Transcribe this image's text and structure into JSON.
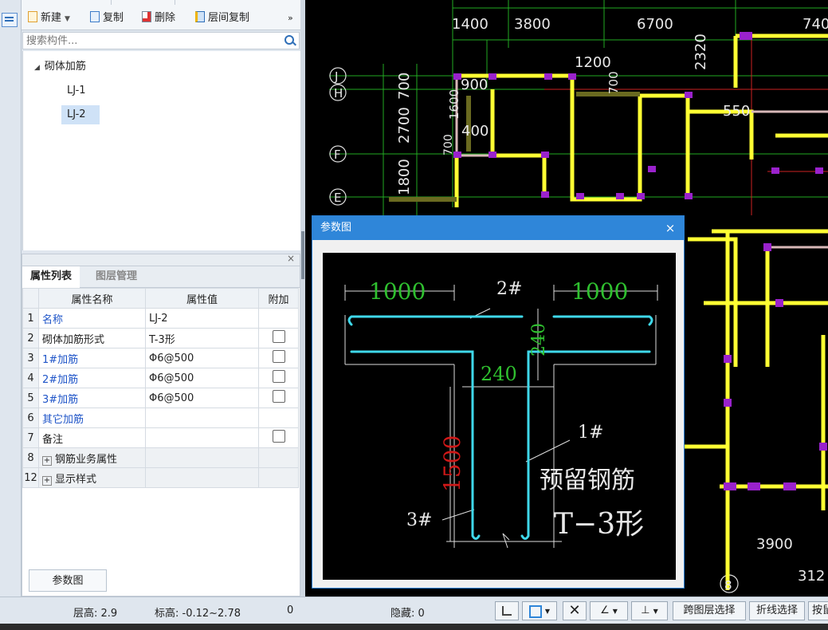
{
  "toolbar": {
    "new_label": "新建",
    "copy_label": "复制",
    "delete_label": "删除",
    "floor_copy_label": "层间复制",
    "more_label": "»"
  },
  "search": {
    "placeholder": "搜索构件..."
  },
  "tree": {
    "root_label": "砌体加筋",
    "items": [
      "LJ-1",
      "LJ-2"
    ],
    "selected": "LJ-2"
  },
  "props": {
    "close_label": "×",
    "tabs": [
      "属性列表",
      "图层管理"
    ],
    "headers": [
      "属性名称",
      "属性值",
      "附加"
    ],
    "rows": [
      {
        "num": "1",
        "name": "名称",
        "value": "LJ-2",
        "check": false
      },
      {
        "num": "2",
        "name": "砌体加筋形式",
        "value": "T-3形",
        "check": true
      },
      {
        "num": "3",
        "name": "1#加筋",
        "value": "Φ6@500",
        "check": true
      },
      {
        "num": "4",
        "name": "2#加筋",
        "value": "Φ6@500",
        "check": true
      },
      {
        "num": "5",
        "name": "3#加筋",
        "value": "Φ6@500",
        "check": true
      },
      {
        "num": "6",
        "name": "其它加筋",
        "value": "",
        "check": false
      },
      {
        "num": "7",
        "name": "备注",
        "value": "",
        "check": true
      },
      {
        "num": "8",
        "name": "钢筋业务属性",
        "value": "",
        "check": false
      },
      {
        "num": "12",
        "name": "显示样式",
        "value": "",
        "check": false
      }
    ],
    "param_button": "参数图"
  },
  "cad": {
    "top_dims": [
      "1400",
      "3800",
      "6700",
      "740"
    ],
    "axes": [
      "J",
      "H",
      "F",
      "E"
    ],
    "side_dims": [
      "2700",
      "700",
      "1800"
    ],
    "labels": [
      "1200",
      "2320",
      "900",
      "1600",
      "700",
      "400",
      "550",
      "700",
      "3900",
      "312",
      "8"
    ]
  },
  "dialog": {
    "title": "参数图",
    "close": "×",
    "dim_top_left": "1000",
    "dim_top_right": "1000",
    "label_2": "2#",
    "dim_240_v": "240",
    "dim_240_h": "240",
    "label_1": "1#",
    "dim_1500": "1500",
    "label_3": "3#",
    "caption1": "预留钢筋",
    "caption2": "T−3形"
  },
  "status": {
    "floor_height": "层高:  2.9",
    "elevation": "标高:  -0.12~2.78",
    "zero": "0",
    "hidden": "隐藏:  0",
    "cross_floor": "跨图层选择",
    "polyline": "折线选择",
    "press": "按鼠"
  }
}
